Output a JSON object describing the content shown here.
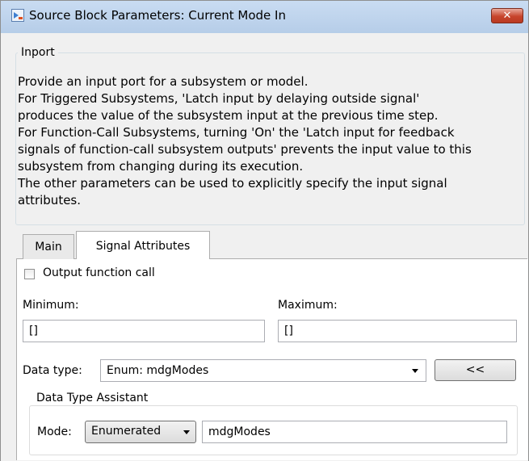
{
  "window": {
    "title": "Source Block Parameters: Current Mode In",
    "close_label": "✕"
  },
  "inport": {
    "legend": "Inport",
    "description": [
      "Provide an input port for a subsystem or model.",
      "For Triggered Subsystems, 'Latch input by delaying outside signal'",
      "produces the value of the subsystem input at the previous time step.",
      "For Function-Call Subsystems, turning 'On' the 'Latch input for feedback",
      "signals of function-call subsystem outputs' prevents the input value to this",
      "subsystem from changing during its execution.",
      "The other parameters can be used to explicitly specify the input signal",
      "attributes."
    ]
  },
  "tabs": [
    {
      "label": "Main",
      "active": false
    },
    {
      "label": "Signal Attributes",
      "active": true
    }
  ],
  "signal_attributes": {
    "output_function_call": {
      "label": "Output function call",
      "checked": false
    },
    "minimum": {
      "label": "Minimum:",
      "value": "[]"
    },
    "maximum": {
      "label": "Maximum:",
      "value": "[]"
    },
    "data_type": {
      "label": "Data type:",
      "value": "Enum: mdgModes",
      "assistant_button": "<<"
    },
    "assistant": {
      "legend": "Data Type Assistant",
      "mode_label": "Mode:",
      "mode_value": "Enumerated",
      "enum_name": "mdgModes"
    }
  },
  "colors": {
    "titlebar": "#c0d5ee",
    "close_button": "#c7442c",
    "dialog_bg": "#f0f0f0",
    "panel_bg": "#ffffff"
  }
}
